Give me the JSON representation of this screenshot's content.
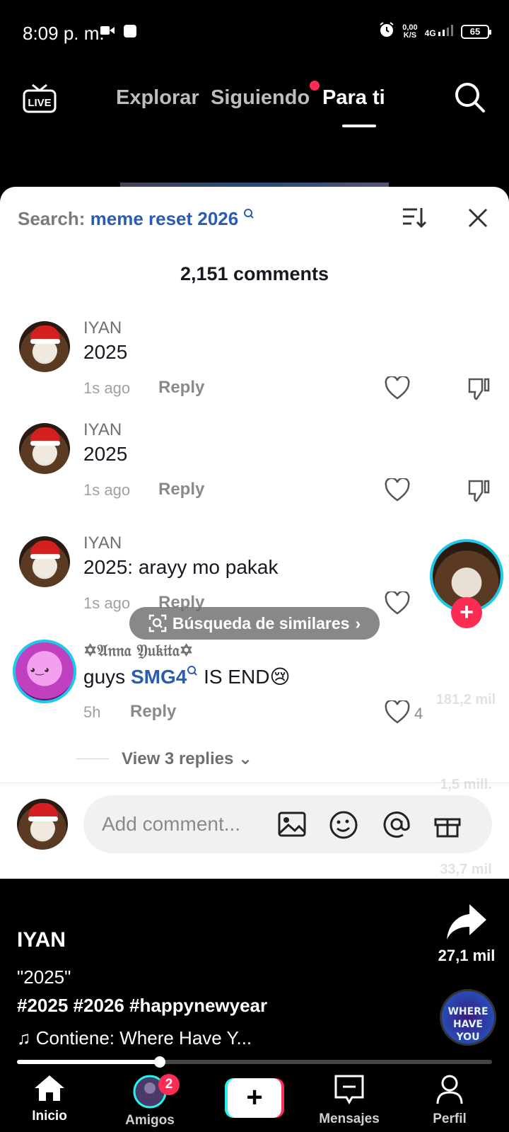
{
  "status_bar": {
    "time": "8:09 p. m.",
    "net_speed": "0,00",
    "net_unit": "K/S",
    "network": "4G",
    "battery": "65"
  },
  "top_nav": {
    "tabs": [
      {
        "label": "Explorar"
      },
      {
        "label": "Siguiendo"
      },
      {
        "label": "Para ti"
      }
    ],
    "active_tab": "Para ti",
    "live_label": "LIVE"
  },
  "comments_sheet": {
    "search_label": "Search:",
    "search_query": "meme reset 2026",
    "count_label": "2,151 comments",
    "comments": [
      {
        "user": "IYAN",
        "text": "2025",
        "time": "1s ago",
        "reply": "Reply"
      },
      {
        "user": "IYAN",
        "text": "2025",
        "time": "1s ago",
        "reply": "Reply"
      },
      {
        "user": "IYAN",
        "text": "2025: arayy mo pakak",
        "time": "1s ago",
        "reply": "Reply"
      },
      {
        "user": "✡𝔄𝔫𝔫𝔞 𝔜𝔲𝔨𝔦𝔱𝔞✡",
        "text_pre": "guys ",
        "text_link": "SMG4",
        "text_post": " IS END😢",
        "time": "5h",
        "reply": "Reply",
        "likes": "4"
      }
    ],
    "similar_search": "Búsqueda de similares",
    "view_replies": "View 3 replies",
    "add_comment_placeholder": "Add comment..."
  },
  "right_rail": {
    "likes": "181,2 mil",
    "comments": "1,5 mill.",
    "saves": "33,7 mil",
    "shares": "27,1 mil",
    "disc_text": "WHERE HAVE YOU BEEN"
  },
  "video": {
    "author": "IYAN",
    "description": "\"2025\"",
    "hashtags": "#2025 #2026 #happynewyear",
    "music": "♫ Contiene: Where Have Y...",
    "progress": 0.3
  },
  "bottom_nav": {
    "items": [
      {
        "label": "Inicio"
      },
      {
        "label": "Amigos"
      },
      {
        "label": "Mensajes"
      },
      {
        "label": "Perfil"
      }
    ],
    "friends_badge": "2",
    "create_symbol": "+"
  },
  "colors": {
    "accent_pink": "#fe2c55",
    "accent_cyan": "#25f4ee",
    "link_blue": "#2a5db0"
  }
}
